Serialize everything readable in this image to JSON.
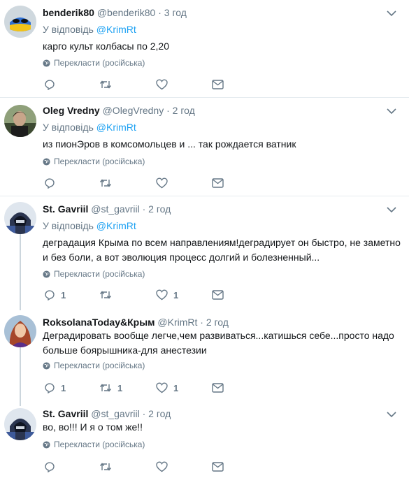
{
  "ui": {
    "reply_prefix": "У відповідь",
    "translate_label": "Перекласти (російська)"
  },
  "tweets": [
    {
      "name": "benderik80",
      "handle": "@benderik80",
      "time": "· 3 год",
      "reply_to": "@KrimRt",
      "text": "карго культ колбасы по 2,20",
      "replies": "",
      "retweets": "",
      "likes": ""
    },
    {
      "name": "Oleg Vredny",
      "handle": "@OlegVredny",
      "time": "· 2 год",
      "reply_to": "@KrimRt",
      "text": "из пионЭров в комсомольцев и ... так рождается ватник",
      "replies": "",
      "retweets": "",
      "likes": ""
    },
    {
      "name": "St. Gavriil",
      "handle": "@st_gavriil",
      "time": "· 2 год",
      "reply_to": "@KrimRt",
      "text": "деградация Крыма по всем направлениям!деградирует он быстро, не заметно и без боли, а вот эволюция процесс долгий и болезненный...",
      "replies": "1",
      "retweets": "",
      "likes": "1"
    },
    {
      "name": "RoksolanaToday&Крым",
      "handle": "@KrimRt",
      "time": "· 2 год",
      "reply_to": "",
      "text": "Деградировать вообще легче,чем развиваться...катишься себе...просто надо больше боярышника-для анестезии",
      "replies": "1",
      "retweets": "1",
      "likes": "1"
    },
    {
      "name": "St. Gavriil",
      "handle": "@st_gavriil",
      "time": "· 2 год",
      "reply_to": "",
      "text": "во, во!!! И я о том же!!",
      "replies": "",
      "retweets": "",
      "likes": ""
    }
  ]
}
